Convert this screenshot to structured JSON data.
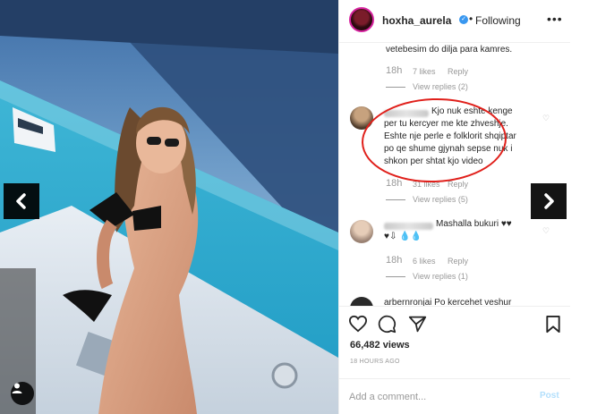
{
  "header": {
    "username": "hoxha_aurela",
    "verified_mark": "✓",
    "separator": "•",
    "follow_status": "Following",
    "more_label": "•••"
  },
  "comments": [
    {
      "partial_text": "vetebesim do dilja para kamres.",
      "time": "18h",
      "likes": "7 likes",
      "reply_label": "Reply",
      "view_replies": "View replies (2)"
    },
    {
      "text": "Kjo nuk eshte kenge per tu kercyer me kte zhveshje. Eshte nje perle e folklorit shqiptar po qe shume gjynah sepse nuk i shkon per shtat kjo video",
      "lines": [
        "Kjo nuk eshte kenge",
        "per tu kercyer me kte zhveshje.",
        "Eshte nje perle e folklorit shqiptar",
        "po qe shume gjynah sepse nuk i",
        "shkon per shtat kjo video"
      ],
      "time": "18h",
      "likes": "31 likes",
      "reply_label": "Reply",
      "view_replies": "View replies (5)"
    },
    {
      "text": "Mashalla bukuri ♥♥",
      "line2": "♥⇩ 💧💧",
      "time": "18h",
      "likes": "6 likes",
      "reply_label": "Reply",
      "view_replies": "View replies (1)"
    },
    {
      "partial_text": "arbernronjai Po kercehet veshur"
    }
  ],
  "actions": {
    "views": "66,482 views",
    "timestamp": "18 HOURS AGO",
    "comment_placeholder": "Add a comment...",
    "post_label": "Post"
  },
  "icons": {
    "like": "heart-icon",
    "comment": "comment-icon",
    "share": "share-icon",
    "save": "bookmark-icon",
    "prev": "chevron-left-icon",
    "next": "chevron-right-icon",
    "user_tag": "user-icon"
  },
  "colors": {
    "annotation_red": "#e0201b",
    "link_blue": "#3897f0",
    "muted": "#999999"
  }
}
